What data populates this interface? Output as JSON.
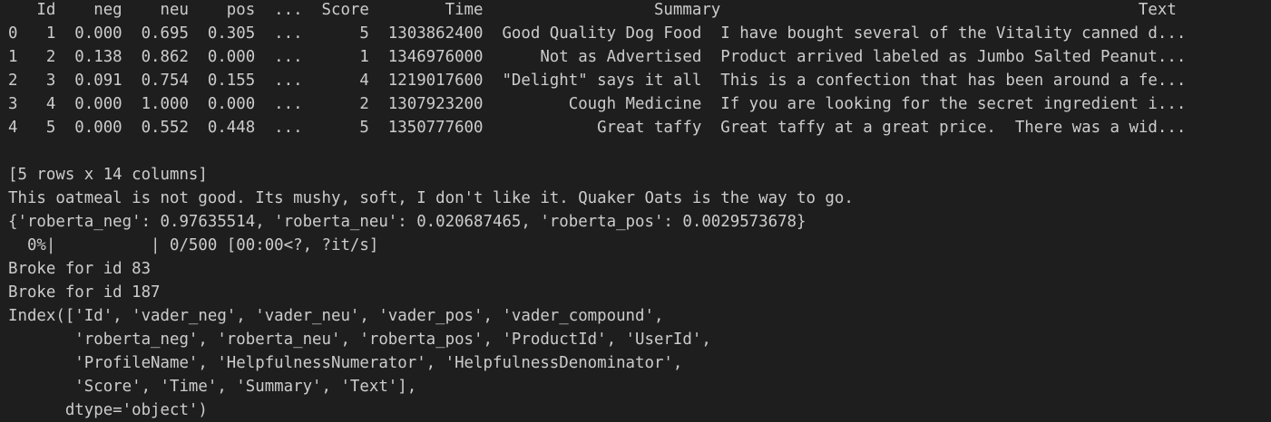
{
  "terminal": {
    "lines": [
      "   Id    neg    neu    pos  ...  Score        Time                  Summary                                            Text",
      "0   1  0.000  0.695  0.305  ...      5  1303862400  Good Quality Dog Food  I have bought several of the Vitality canned d...",
      "1   2  0.138  0.862  0.000  ...      1  1346976000      Not as Advertised  Product arrived labeled as Jumbo Salted Peanut...",
      "2   3  0.091  0.754  0.155  ...      4  1219017600  \"Delight\" says it all  This is a confection that has been around a fe...",
      "3   4  0.000  1.000  0.000  ...      2  1307923200         Cough Medicine  If you are looking for the secret ingredient i...",
      "4   5  0.000  0.552  0.448  ...      5  1350777600            Great taffy  Great taffy at a great price.  There was a wid...",
      "",
      "[5 rows x 14 columns]",
      "This oatmeal is not good. Its mushy, soft, I don't like it. Quaker Oats is the way to go.",
      "{'roberta_neg': 0.97635514, 'roberta_neu': 0.020687465, 'roberta_pos': 0.0029573678}",
      "  0%|          | 0/500 [00:00<?, ?it/s]",
      "Broke for id 83",
      "Broke for id 187",
      "Index(['Id', 'vader_neg', 'vader_neu', 'vader_pos', 'vader_compound',",
      "       'roberta_neg', 'roberta_neu', 'roberta_pos', 'ProductId', 'UserId',",
      "       'ProfileName', 'HelpfulnessNumerator', 'HelpfulnessDenominator',",
      "       'Score', 'Time', 'Summary', 'Text'],",
      "      dtype='object')"
    ]
  },
  "colors": {
    "background": "#1e1e1e",
    "text": "#cccccc"
  }
}
